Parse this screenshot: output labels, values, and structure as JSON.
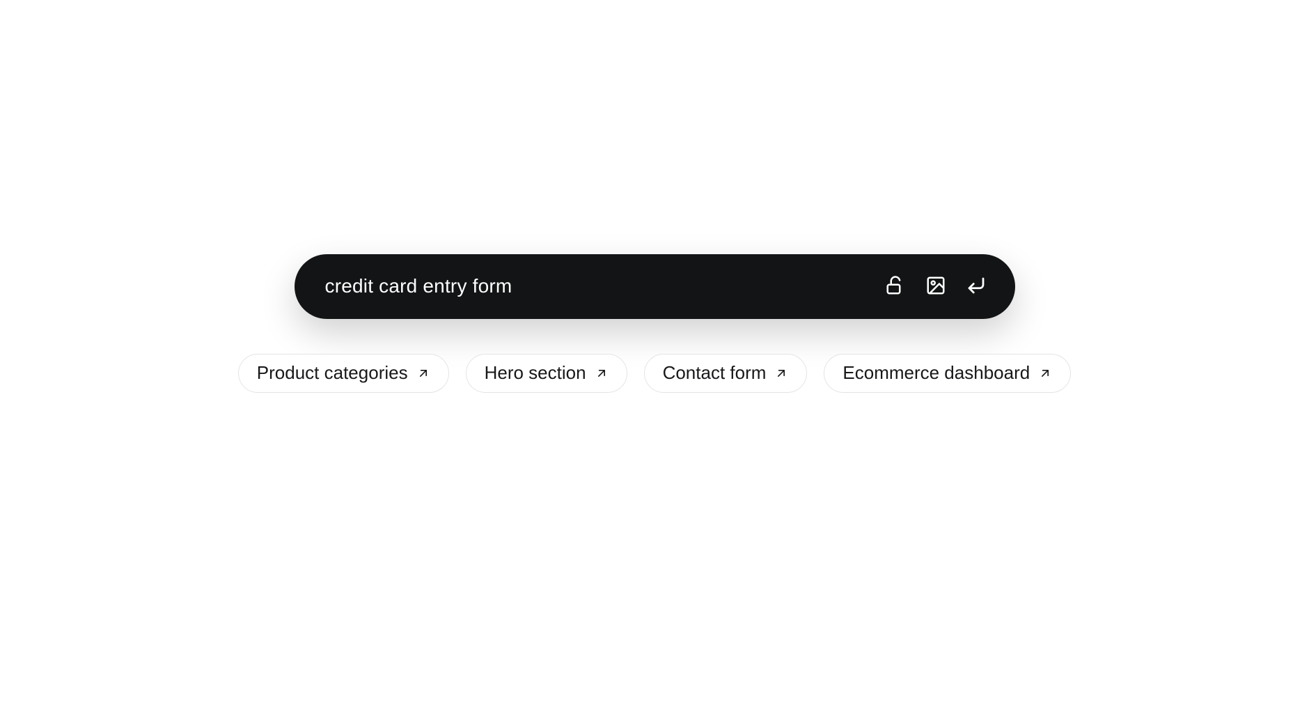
{
  "command": {
    "value": "credit card entry form",
    "placeholder": ""
  },
  "icons": {
    "lock": "unlock-icon",
    "image": "image-icon",
    "submit": "enter-icon"
  },
  "suggestions": [
    {
      "label": "Product categories"
    },
    {
      "label": "Hero section"
    },
    {
      "label": "Contact form"
    },
    {
      "label": "Ecommerce dashboard"
    }
  ]
}
